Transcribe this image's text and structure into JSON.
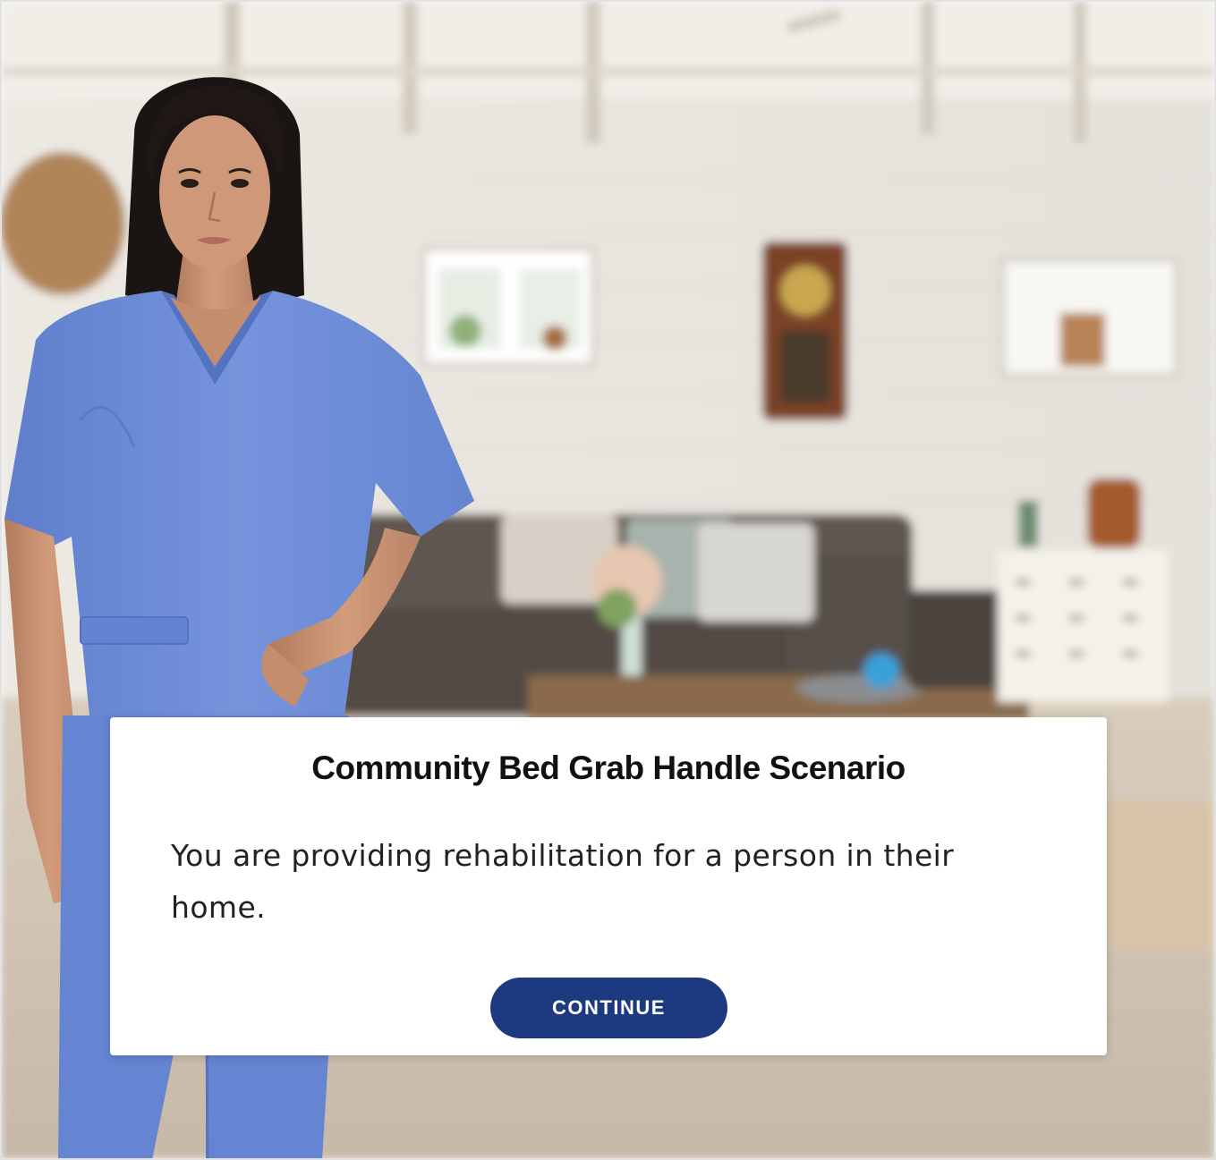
{
  "scene": {
    "background": "blurred-living-room-photo",
    "character": "nurse-in-blue-scrubs",
    "colors": {
      "scrubs": "#6f8fd8",
      "wall": "#e9e6e0",
      "sofa": "#5a524c",
      "floor": "#cdbfae",
      "button": "#1d3a80"
    }
  },
  "dialog": {
    "title": "Community Bed Grab Handle Scenario",
    "body": "You are providing rehabilitation for a person in their home.",
    "continue_label": "CONTINUE"
  }
}
